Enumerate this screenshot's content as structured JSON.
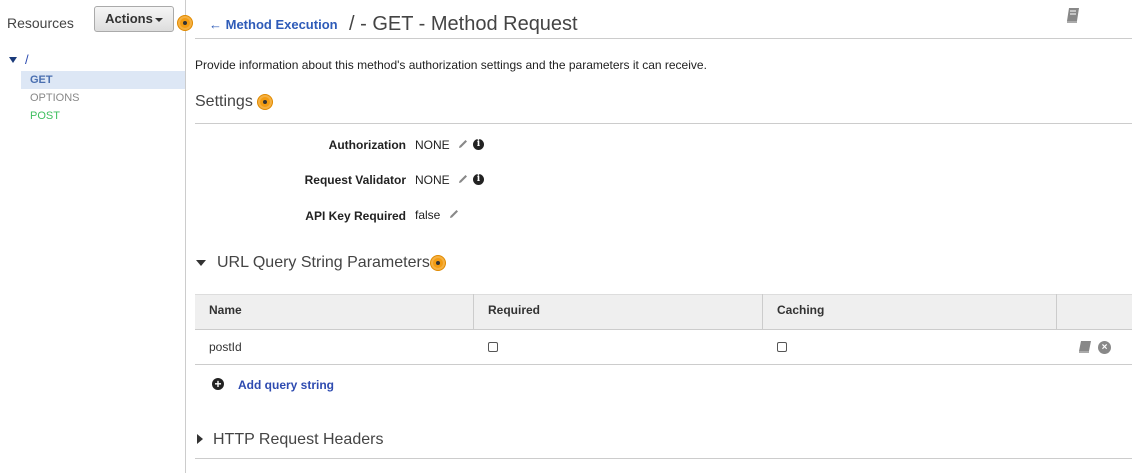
{
  "sidebar": {
    "resources_label": "Resources",
    "actions_label": "Actions",
    "root_path": "/",
    "methods": [
      "GET",
      "OPTIONS",
      "POST"
    ]
  },
  "header": {
    "back_link": "Method Execution",
    "title": "/ - GET - Method Request"
  },
  "description": "Provide information about this method's authorization settings and the parameters it can receive.",
  "settings": {
    "title": "Settings",
    "fields": [
      {
        "label": "Authorization",
        "value": "NONE"
      },
      {
        "label": "Request Validator",
        "value": "NONE"
      },
      {
        "label": "API Key Required",
        "value": "false"
      }
    ]
  },
  "query_params": {
    "title": "URL Query String Parameters",
    "columns": [
      "Name",
      "Required",
      "Caching"
    ],
    "rows": [
      {
        "name": "postId",
        "required": false,
        "caching": false
      }
    ],
    "add_label": "Add query string"
  },
  "headers_section": {
    "title": "HTTP Request Headers"
  },
  "colors": {
    "link": "#2e5bb8",
    "post": "#3fbf5f",
    "selected_bg": "#dde7f5",
    "help_dot": "#f39c12"
  }
}
